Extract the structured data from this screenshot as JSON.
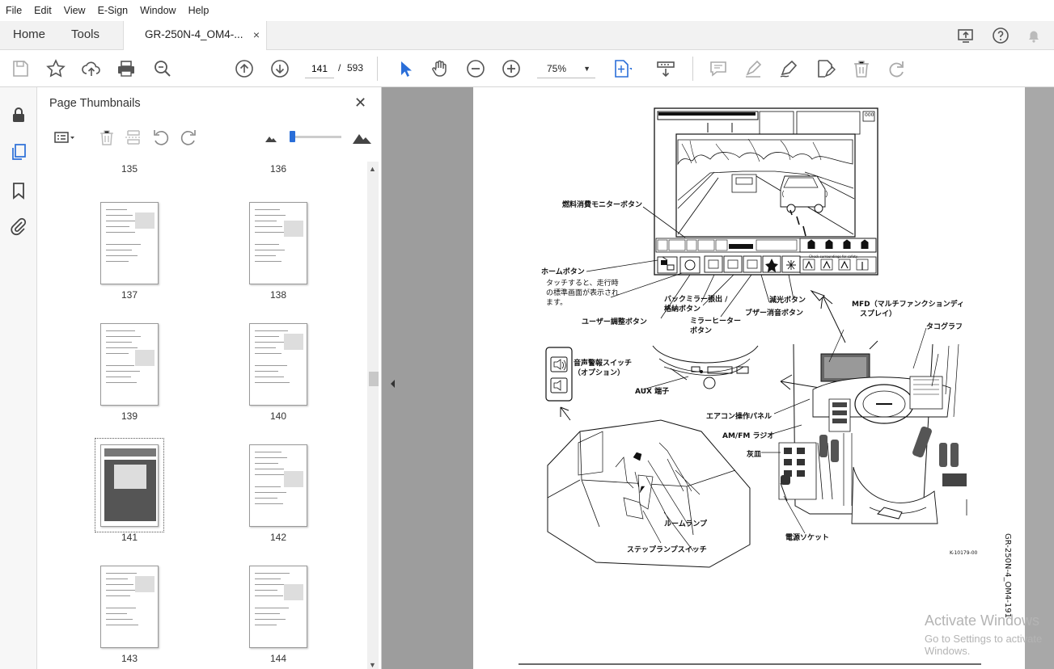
{
  "menu": [
    "File",
    "Edit",
    "View",
    "E-Sign",
    "Window",
    "Help"
  ],
  "tabs": {
    "home": "Home",
    "tools": "Tools",
    "document": "GR-250N-4_OM4-...",
    "close": "×"
  },
  "toolbar": {
    "current_page": "141",
    "page_separator": "/",
    "total_pages": "593",
    "zoom": "75%"
  },
  "panel": {
    "title": "Page Thumbnails",
    "close": "✕",
    "top_labels": [
      "135",
      "136"
    ],
    "thumbnails": [
      "137",
      "138",
      "139",
      "140",
      "141",
      "142",
      "143",
      "144"
    ],
    "selected": "141"
  },
  "page": {
    "labels": {
      "fuel_monitor": "燃料消費モニターボタン",
      "home_button": "ホームボタン",
      "home_desc1": "タッチすると、走行時",
      "home_desc2": "の標準画面が表示され",
      "home_desc3": "ます。",
      "user_adjust": "ユーザー調整ボタン",
      "back_mirror1": "バックミラー張出 /",
      "back_mirror2": "格納ボタン",
      "mirror_heater1": "ミラーヒーター",
      "mirror_heater2": "ボタン",
      "buzzer": "ブザー消音ボタン",
      "dimmer": "減光ボタン",
      "mfd1": "MFD（マルチファンクションディ",
      "mfd2": "スプレイ）",
      "tachograph": "タコグラフ",
      "alarm_switch1": "音声警報スイッチ",
      "alarm_switch2": "（オプション）",
      "aux": "AUX 端子",
      "aircon": "エアコン操作パネル",
      "radio": "AM/FM ラジオ",
      "ashtray": "灰皿",
      "room_lamp": "ルームランプ",
      "step_lamp": "ステップランプスイッチ",
      "power_socket": "電源ソケット",
      "figure_code": "K-10179-00",
      "side_code": "GR-250N-4_OM4-191",
      "screen_msg": "Check surroundings for safety.",
      "screen_counter": "000"
    }
  },
  "watermark": {
    "line1": "Activate Windows",
    "line2": "Go to Settings to activate Windows."
  }
}
